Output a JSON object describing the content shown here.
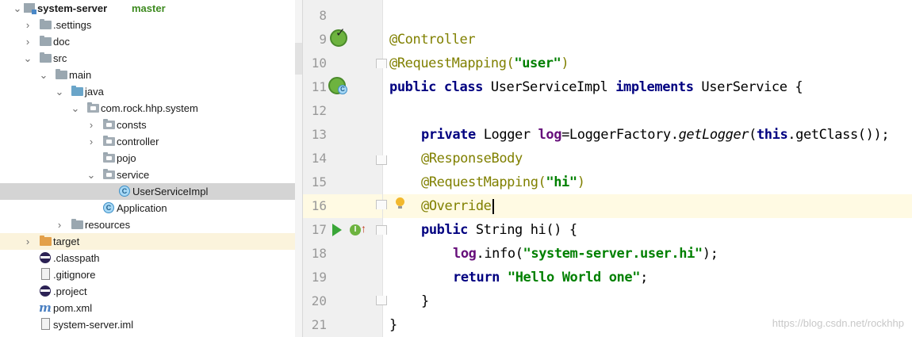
{
  "project": {
    "name": "system-server",
    "branch": "master"
  },
  "tree": [
    {
      "label": "system-server",
      "icon": "module-icon",
      "expanded": true,
      "depth": 0
    },
    {
      "label": ".settings",
      "icon": "folder-icon",
      "expanded": false,
      "depth": 1
    },
    {
      "label": "doc",
      "icon": "folder-icon",
      "expanded": false,
      "depth": 1
    },
    {
      "label": "src",
      "icon": "folder-icon",
      "expanded": true,
      "depth": 1
    },
    {
      "label": "main",
      "icon": "folder-icon",
      "expanded": true,
      "depth": 2
    },
    {
      "label": "java",
      "icon": "source-folder-icon",
      "expanded": true,
      "depth": 3
    },
    {
      "label": "com.rock.hhp.system",
      "icon": "package-icon",
      "expanded": true,
      "depth": 4
    },
    {
      "label": "consts",
      "icon": "package-icon",
      "expanded": false,
      "depth": 5
    },
    {
      "label": "controller",
      "icon": "package-icon",
      "expanded": false,
      "depth": 5
    },
    {
      "label": "pojo",
      "icon": "package-icon",
      "depth": 5
    },
    {
      "label": "service",
      "icon": "package-icon",
      "expanded": true,
      "depth": 5
    },
    {
      "label": "UserServiceImpl",
      "icon": "class-icon",
      "depth": 6,
      "selected": true
    },
    {
      "label": "Application",
      "icon": "spring-class-icon",
      "depth": 5
    },
    {
      "label": "resources",
      "icon": "folder-icon",
      "expanded": false,
      "depth": 3
    },
    {
      "label": "target",
      "icon": "excluded-folder-icon",
      "expanded": false,
      "depth": 1
    },
    {
      "label": ".classpath",
      "icon": "eclipse-icon",
      "depth": 1
    },
    {
      "label": ".gitignore",
      "icon": "file-icon",
      "depth": 1
    },
    {
      "label": ".project",
      "icon": "eclipse-icon",
      "depth": 1
    },
    {
      "label": "pom.xml",
      "icon": "maven-icon",
      "depth": 1
    },
    {
      "label": "system-server.iml",
      "icon": "iml-file-icon",
      "depth": 1
    }
  ],
  "editor": {
    "line_numbers": [
      "8",
      "9",
      "10",
      "11",
      "12",
      "13",
      "14",
      "15",
      "16",
      "17",
      "18",
      "19",
      "20",
      "21"
    ],
    "lines": {
      "l9": {
        "a": "@Controller"
      },
      "l10": {
        "a": "@RequestMapping(",
        "s": "\"user\"",
        "b": ")"
      },
      "l11": {
        "k1": "public class ",
        "t": "UserServiceImpl ",
        "k2": "implements ",
        "t2": "UserService {"
      },
      "l13": {
        "k": "private ",
        "t": "Logger ",
        "f": "log",
        "t2": "=LoggerFactory.",
        "i": "getLogger",
        "t3": "(",
        "k2": "this",
        "t4": ".getClass());"
      },
      "l14": {
        "a": "@ResponseBody"
      },
      "l15": {
        "a": "@RequestMapping(",
        "s": "\"hi\"",
        "b": ")"
      },
      "l16": {
        "a": "@Override"
      },
      "l17": {
        "k": "public ",
        "t": "String hi() {"
      },
      "l18": {
        "f": "log",
        "t": ".info(",
        "s": "\"system-server.user.hi\"",
        "t2": ");"
      },
      "l19": {
        "k": "return ",
        "s": "\"Hello World one\"",
        "t": ";"
      },
      "l20": {
        "t": "}"
      },
      "l21": {
        "t": "}"
      }
    }
  },
  "watermark": "https://blog.csdn.net/rockhhp",
  "colors": {
    "keyword": "#000080",
    "annotation": "#808000",
    "string": "#008000",
    "field": "#660e7a",
    "caret_row": "#fffae3",
    "selection": "#d4d4d4"
  }
}
